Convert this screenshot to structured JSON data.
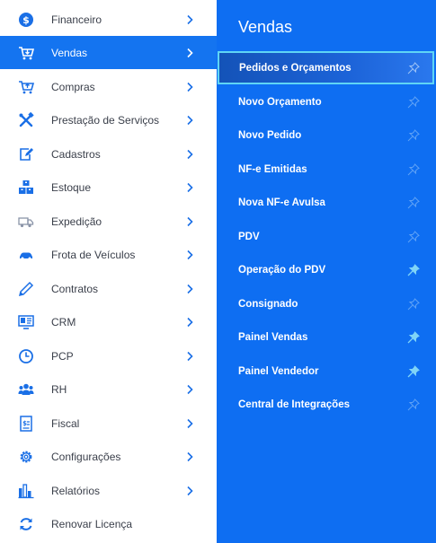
{
  "colors": {
    "accent": "#1474f0",
    "submenu_bg": "#0e6ef2",
    "icon_blue": "#1a6fe6",
    "selected_border": "#5fd5f5"
  },
  "sidebar": {
    "items": [
      {
        "label": "Financeiro",
        "icon": "dollar-circle-icon"
      },
      {
        "label": "Vendas",
        "icon": "cart-icon"
      },
      {
        "label": "Compras",
        "icon": "cart-icon"
      },
      {
        "label": "Prestação de Serviços",
        "icon": "tools-icon"
      },
      {
        "label": "Cadastros",
        "icon": "edit-icon"
      },
      {
        "label": "Estoque",
        "icon": "boxes-icon"
      },
      {
        "label": "Expedição",
        "icon": "truck-icon"
      },
      {
        "label": "Frota de Veículos",
        "icon": "car-icon"
      },
      {
        "label": "Contratos",
        "icon": "pen-icon"
      },
      {
        "label": "CRM",
        "icon": "monitor-icon"
      },
      {
        "label": "PCP",
        "icon": "clock-icon"
      },
      {
        "label": "RH",
        "icon": "people-icon"
      },
      {
        "label": "Fiscal",
        "icon": "document-icon"
      },
      {
        "label": "Configurações",
        "icon": "gear-icon"
      },
      {
        "label": "Relatórios",
        "icon": "bar-chart-icon"
      },
      {
        "label": "Renovar Licença",
        "icon": "refresh-icon"
      }
    ]
  },
  "submenu": {
    "title": "Vendas",
    "items": [
      {
        "label": "Pedidos e Orçamentos",
        "pinned": false
      },
      {
        "label": "Novo Orçamento",
        "pinned": false
      },
      {
        "label": "Novo Pedido",
        "pinned": false
      },
      {
        "label": "NF-e Emitidas",
        "pinned": false
      },
      {
        "label": "Nova NF-e Avulsa",
        "pinned": false
      },
      {
        "label": "PDV",
        "pinned": false
      },
      {
        "label": "Operação do PDV",
        "pinned": true
      },
      {
        "label": "Consignado",
        "pinned": false
      },
      {
        "label": "Painel Vendas",
        "pinned": true
      },
      {
        "label": "Painel Vendedor",
        "pinned": true
      },
      {
        "label": "Central de Integrações",
        "pinned": false
      }
    ]
  }
}
